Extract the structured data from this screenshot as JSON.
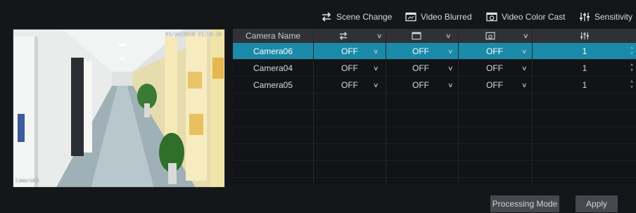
{
  "legend": {
    "scene_change": "Scene Change",
    "video_blurred": "Video Blurred",
    "video_color_cast": "Video Color Cast",
    "sensitivity": "Sensitivity"
  },
  "preview": {
    "timestamp": "03/24/2018 21:19:16",
    "camera_label": "Camera05"
  },
  "table": {
    "header_name": "Camera Name",
    "rows": [
      {
        "name": "Camera06",
        "scene": "OFF",
        "blur": "OFF",
        "cast": "OFF",
        "sensitivity": "1",
        "selected": true
      },
      {
        "name": "Camera04",
        "scene": "OFF",
        "blur": "OFF",
        "cast": "OFF",
        "sensitivity": "1",
        "selected": false
      },
      {
        "name": "Camera05",
        "scene": "OFF",
        "blur": "OFF",
        "cast": "OFF",
        "sensitivity": "1",
        "selected": false
      }
    ]
  },
  "buttons": {
    "processing_mode": "Processing Mode",
    "apply": "Apply"
  },
  "colors": {
    "selected_row": "#1a8aa8",
    "background": "#15161a",
    "header": "#2f3136"
  }
}
